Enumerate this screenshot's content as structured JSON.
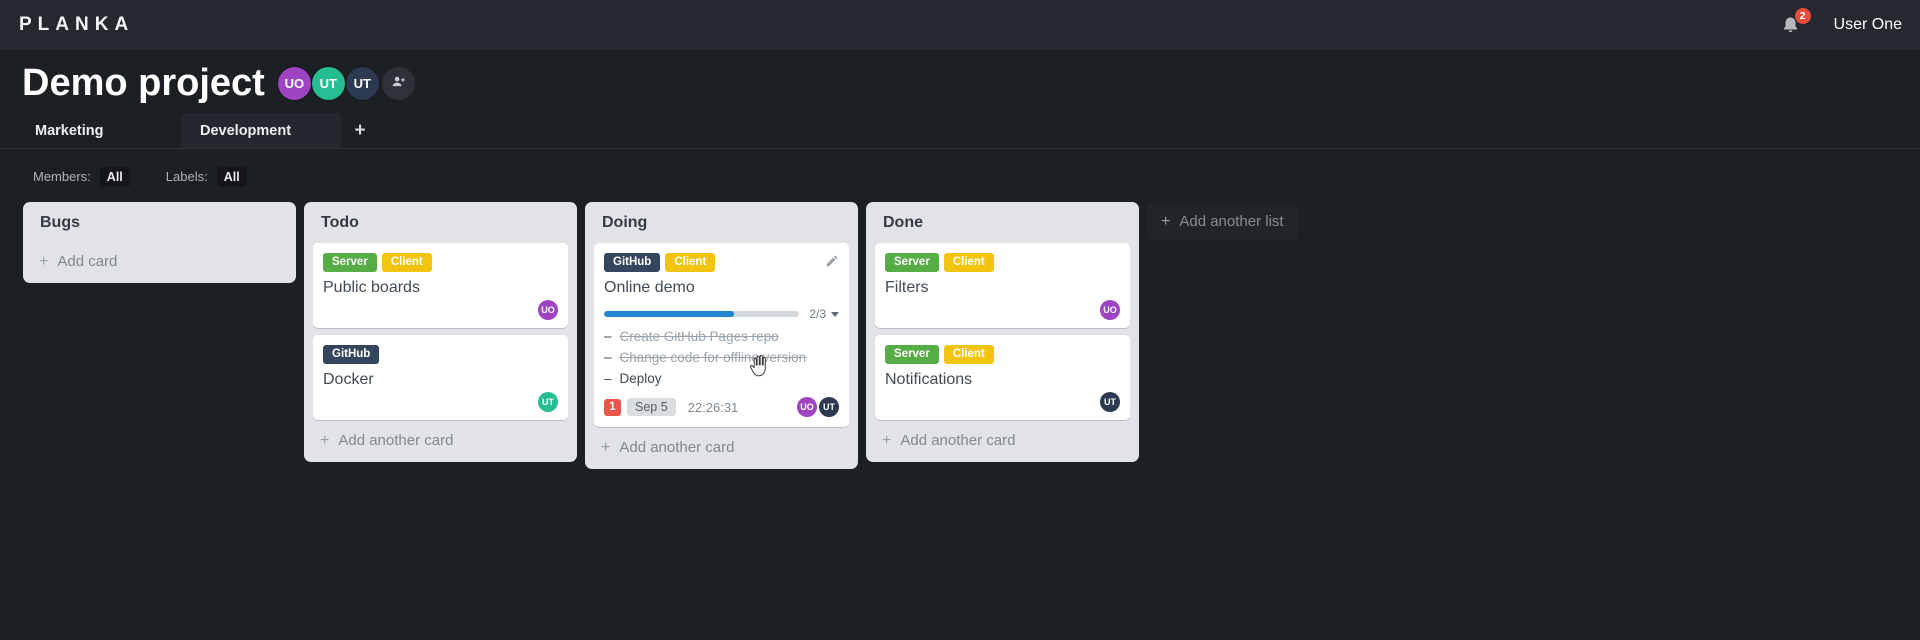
{
  "topbar": {
    "logo": "PLANKA",
    "notifications_count": "2",
    "user_name": "User One"
  },
  "project": {
    "title": "Demo project",
    "members": [
      {
        "initials": "UO",
        "color": "#9e44c3"
      },
      {
        "initials": "UT",
        "color": "#26bd92"
      },
      {
        "initials": "UT",
        "color": "#2b3a50"
      }
    ]
  },
  "tabs": {
    "items": [
      {
        "label": "Marketing",
        "active": false
      },
      {
        "label": "Development",
        "active": true
      }
    ],
    "add_button": "+"
  },
  "filters": {
    "members_label": "Members:",
    "members_value": "All",
    "labels_label": "Labels:",
    "labels_value": "All"
  },
  "board": {
    "add_list_label": "Add another list",
    "lists": [
      {
        "name": "Bugs",
        "add_card_label": "Add card",
        "cards": []
      },
      {
        "name": "Todo",
        "add_card_label": "Add another card",
        "cards": [
          {
            "title": "Public boards",
            "labels": [
              {
                "text": "Server",
                "color": "#57ad45"
              },
              {
                "text": "Client",
                "color": "#f1c40f"
              }
            ],
            "members": [
              {
                "initials": "UO",
                "color": "#9e44c3"
              }
            ]
          },
          {
            "title": "Docker",
            "labels": [
              {
                "text": "GitHub",
                "color": "#35455d"
              }
            ],
            "members": [
              {
                "initials": "UT",
                "color": "#26bd92"
              }
            ]
          }
        ]
      },
      {
        "name": "Doing",
        "add_card_label": "Add another card",
        "cards": [
          {
            "title": "Online demo",
            "editable": true,
            "labels": [
              {
                "text": "GitHub",
                "color": "#35455d"
              },
              {
                "text": "Client",
                "color": "#f1c40f"
              }
            ],
            "progress": {
              "completed": 2,
              "total": 3,
              "label": "2/3",
              "color": "#2185d0"
            },
            "tasks": [
              {
                "text": "Create GitHub Pages repo",
                "done": true
              },
              {
                "text": "Change code for offline version",
                "done": true
              },
              {
                "text": "Deploy",
                "done": false
              }
            ],
            "notification_count": "1",
            "due_date": "Sep 5",
            "stopwatch": "22:26:31",
            "members": [
              {
                "initials": "UO",
                "color": "#9e44c3"
              },
              {
                "initials": "UT",
                "color": "#2b3a50"
              }
            ]
          }
        ]
      },
      {
        "name": "Done",
        "add_card_label": "Add another card",
        "cards": [
          {
            "title": "Filters",
            "labels": [
              {
                "text": "Server",
                "color": "#57ad45"
              },
              {
                "text": "Client",
                "color": "#f1c40f"
              }
            ],
            "members": [
              {
                "initials": "UO",
                "color": "#9e44c3"
              }
            ]
          },
          {
            "title": "Notifications",
            "labels": [
              {
                "text": "Server",
                "color": "#57ad45"
              },
              {
                "text": "Client",
                "color": "#f1c40f"
              }
            ],
            "members": [
              {
                "initials": "UT",
                "color": "#2b3a50"
              }
            ]
          }
        ]
      }
    ]
  }
}
